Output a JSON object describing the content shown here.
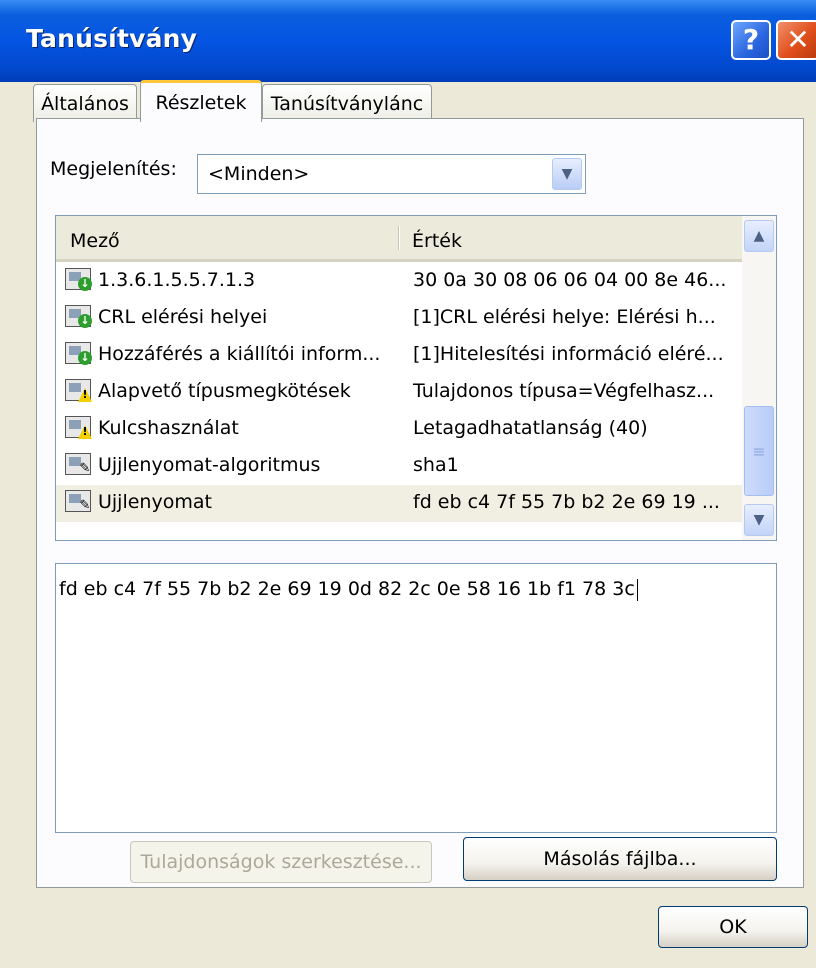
{
  "window": {
    "title": "Tanúsítvány",
    "help_label": "?",
    "close_label": "✕"
  },
  "tabs": [
    {
      "label": "Általános"
    },
    {
      "label": "Részletek"
    },
    {
      "label": "Tanúsítványlánc"
    }
  ],
  "show": {
    "label": "Megjelenítés:",
    "value": "<Minden>"
  },
  "list": {
    "headers": {
      "field": "Mező",
      "value": "Érték"
    },
    "rows": [
      {
        "icon": "cert-ext-icon",
        "field": "1.3.6.1.5.5.7.1.3",
        "value": "30 0a 30 08 06 06 04 00 8e 46..."
      },
      {
        "icon": "cert-ext-icon",
        "field": "CRL elérési helyei",
        "value": "[1]CRL elérési helye: Elérési h..."
      },
      {
        "icon": "cert-ext-icon",
        "field": "Hozzáférés a kiállítói inform...",
        "value": "[1]Hitelesítési információ eléré..."
      },
      {
        "icon": "cert-critical-icon",
        "field": "Alapvető típusmegkötések",
        "value": "Tulajdonos típusa=Végfelhasz..."
      },
      {
        "icon": "cert-critical-icon",
        "field": "Kulcshasználat",
        "value": "Letagadhatatlanság (40)"
      },
      {
        "icon": "cert-property-icon",
        "field": "Ujjlenyomat-algoritmus",
        "value": "sha1"
      },
      {
        "icon": "cert-property-icon",
        "field": "Ujjlenyomat",
        "value": "fd eb c4 7f 55 7b b2 2e 69 19 ..."
      }
    ]
  },
  "detail": {
    "text": "fd eb c4 7f 55 7b b2 2e 69 19 0d 82 2c 0e 58 16 1b f1 78 3c"
  },
  "buttons": {
    "edit_properties": "Tulajdonságok szerkesztése...",
    "copy_to_file": "Másolás fájlba...",
    "ok": "OK"
  }
}
